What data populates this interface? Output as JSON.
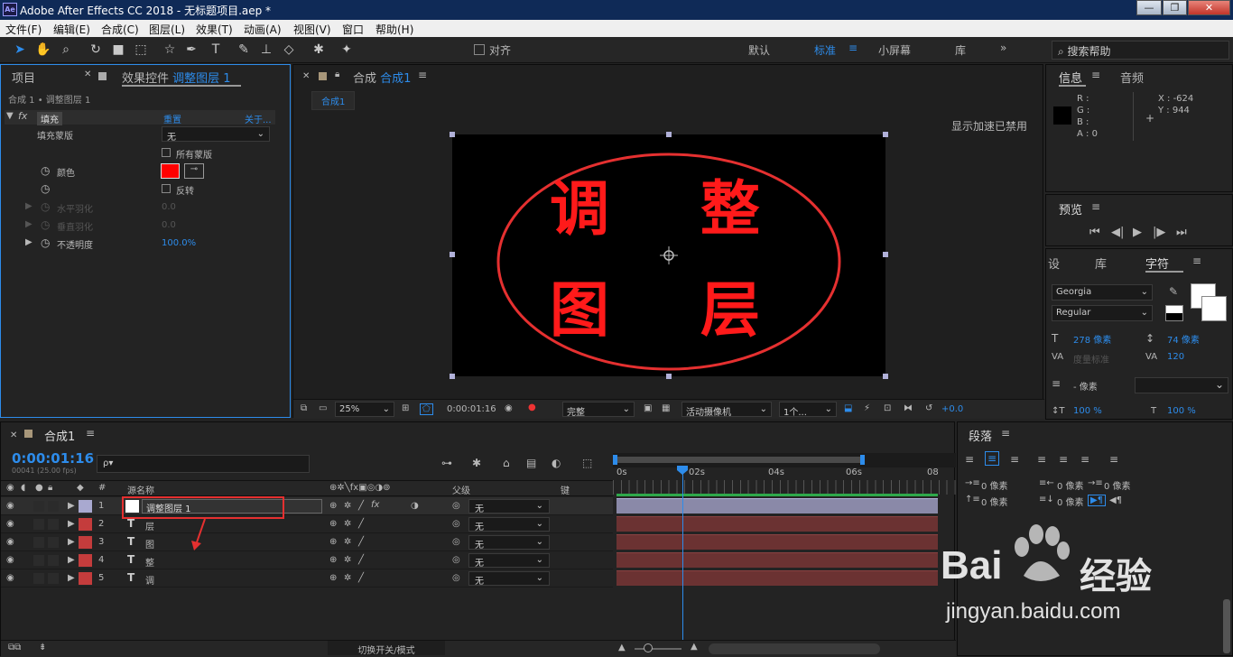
{
  "app": {
    "logo": "Ae",
    "title": "Adobe After Effects CC 2018 - 无标题项目.aep *"
  },
  "window_controls": [
    "—",
    "❐",
    "✕"
  ],
  "menu": [
    "文件(F)",
    "编辑(E)",
    "合成(C)",
    "图层(L)",
    "效果(T)",
    "动画(A)",
    "视图(V)",
    "窗口",
    "帮助(H)"
  ],
  "toolbar": {
    "align_label": "对齐",
    "workspaces": [
      "默认",
      "标准",
      "小屏幕",
      "库"
    ],
    "search_placeholder": "搜索帮助"
  },
  "effects_panel": {
    "tab_project": "项目",
    "tab_effects": "效果控件",
    "tab_layer": "调整图层 1",
    "breadcrumb": "合成 1 • 调整图层 1",
    "fx_name": "填充",
    "reset": "重置",
    "about": "关于...",
    "mask_label": "填充蒙版",
    "mask_value": "无",
    "all_masks": "所有蒙版",
    "color_label": "颜色",
    "invert": "反转",
    "h_feather": "水平羽化",
    "h_feather_val": "0.0",
    "v_feather": "垂直羽化",
    "v_feather_val": "0.0",
    "opacity": "不透明度",
    "opacity_val": "100.0%"
  },
  "comp_panel": {
    "tab_prefix": "合成",
    "tab_name": "合成1",
    "sub_tab": "合成1",
    "gpu_notice": "显示加速已禁用",
    "canvas_chars": [
      "调",
      "整",
      "图",
      "层"
    ],
    "zoom": "25%",
    "timecode": "0:00:01:16",
    "quality": "完整",
    "camera": "活动摄像机",
    "views": "1个...",
    "exposure": "+0.0"
  },
  "info_panel": {
    "tab_info": "信息",
    "tab_audio": "音频",
    "r": "R :",
    "g": "G :",
    "b": "B :",
    "a": "A : 0",
    "x": "X : -624",
    "y": "Y : 944"
  },
  "preview_panel": {
    "title": "预览"
  },
  "char_panel": {
    "tabs": [
      "设",
      "库",
      "字符"
    ],
    "font": "Georgia",
    "style": "Regular",
    "size": "278 像素",
    "leading": "74 像素",
    "kerning": "度量标准",
    "tracking": "120",
    "stroke": "- 像素",
    "vscale": "100 %",
    "hscale": "100 %"
  },
  "para_panel": {
    "title": "段落",
    "zero": "0 像素"
  },
  "timeline": {
    "tab": "合成1",
    "timecode": "0:00:01:16",
    "frames": "00041 (25.00 fps)",
    "search_placeholder": "ρ▾",
    "col_num": "#",
    "col_name": "源名称",
    "col_parent": "父级",
    "col_key": "键",
    "ruler": [
      "0s",
      "02s",
      "04s",
      "06s",
      "08"
    ],
    "footer": "切换开关/模式",
    "layers": [
      {
        "num": "1",
        "type": "adj",
        "name": "调整图层 1",
        "parent": "无",
        "color": "#a9a9d0"
      },
      {
        "num": "2",
        "type": "T",
        "name": "层",
        "parent": "无",
        "color": "#c43c3c"
      },
      {
        "num": "3",
        "type": "T",
        "name": "图",
        "parent": "无",
        "color": "#c43c3c"
      },
      {
        "num": "4",
        "type": "T",
        "name": "整",
        "parent": "无",
        "color": "#c43c3c"
      },
      {
        "num": "5",
        "type": "T",
        "name": "调",
        "parent": "无",
        "color": "#c43c3c"
      }
    ]
  },
  "watermark": {
    "brand_left": "Bai",
    "brand_right": "经验",
    "url": "jingyan.baidu.com"
  }
}
